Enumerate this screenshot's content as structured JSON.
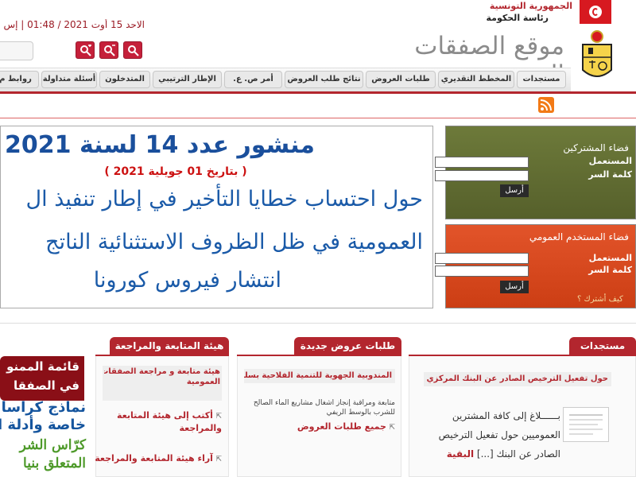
{
  "header": {
    "republic": "الجمهورية التونسية",
    "presidency": "رئاسة الحكومة",
    "site_title": "موقع الصفقات العمومية",
    "datetime": "الاحد 15 أوت 2021 / 01:48 | إس"
  },
  "menu": [
    "مستجدات",
    "المخطط التقديري",
    "طلبات العروض",
    "نتائج طلب العروض",
    "أمر ص. ع.",
    "الإطار الترتيبي",
    "المتدخلون",
    "أسئلة متداولة",
    "روابط م"
  ],
  "announcement": {
    "title": "منشور عدد 14 لسنة 2021",
    "date": "( بتاريخ 01 جويلية 2021 )",
    "line1": "حول احتساب خطايا التأخير في إطار تنفيذ ال",
    "line2": "العمومية في ظل الظروف الاستثنائية الناتج",
    "line3": "انتشار فيروس كورونا"
  },
  "subscriber_login": {
    "title": "فضاء المشتركين",
    "user_label": "المستعمل",
    "password_label": "كلمة السر",
    "send": "أرسل"
  },
  "public_login": {
    "title": "فضاء المستخدم العمومي",
    "user_label": "المستعمل",
    "password_label": "كلمة السر",
    "send": "أرسل",
    "forgot": "كيف أشترك ؟"
  },
  "news": {
    "heading": "مستجدات",
    "subheading": "حول تفعيل الترخيص الصادر عن البنك المركزي التونسي",
    "body1": "بــــــلاغ إلى كافة المشترين",
    "body2": "العموميين حول تفعيل الترخيص",
    "body3": "الصادر عن البنك [...]",
    "more": "البقية"
  },
  "tenders": {
    "heading": "طلبات عروض جديدة",
    "subheading": "المندوبية الجهوية للتنمية الفلاحية بسليانة",
    "body1": "متابعة ومراقبة إنجاز أشغال مشاريع الماء الصالح",
    "body2": "للشرب بالوسط الريفي",
    "all": "جميع طلبات العروض"
  },
  "review_board": {
    "heading": "هيئة المتابعة والمراجعة",
    "item1a": "هيئة متابعة و مراجعة الصفقات",
    "item1b": "العمومية",
    "item2a": "أكتب إلى هيئة المتابعة",
    "item2b": "والمراجعة",
    "item3": "آراء هيئة المتابعة والمراجعة"
  },
  "right_column": {
    "box_line1": "قائمة الممنو",
    "box_line2": "في الصفقا",
    "blue_line1": "نماذج كراسا",
    "blue_line2": "خاصة وأدلة ال",
    "green_line1": "كرّاس الشر",
    "green_line2": "المتعلق بنيا"
  },
  "colors": {
    "brand_red": "#b3262e",
    "subscriber_green": "#6d7a3a",
    "public_orange": "#e2542a",
    "announcement_blue": "#1a4f9c"
  }
}
